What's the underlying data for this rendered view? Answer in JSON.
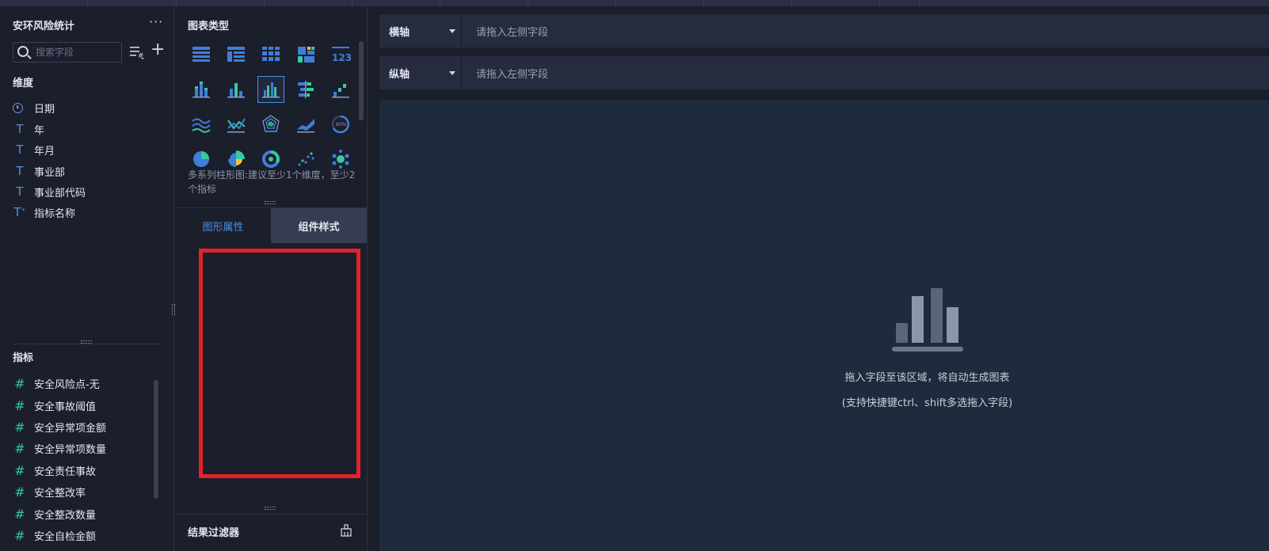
{
  "dataset": {
    "title": "安环风险统计",
    "more": "···",
    "search_placeholder": "搜索字段"
  },
  "dimensions": {
    "label": "维度",
    "items": [
      {
        "icon": "clock-icon",
        "label": "日期"
      },
      {
        "icon": "text-type-icon",
        "label": "年"
      },
      {
        "icon": "text-type-icon",
        "label": "年月"
      },
      {
        "icon": "text-type-icon",
        "label": "事业部"
      },
      {
        "icon": "text-type-icon",
        "label": "事业部代码"
      },
      {
        "icon": "text-type-calc-icon",
        "label": "指标名称"
      }
    ]
  },
  "metrics": {
    "label": "指标",
    "items": [
      {
        "icon": "hash-icon",
        "label": "安全风险点-无"
      },
      {
        "icon": "hash-icon",
        "label": "安全事故阈值"
      },
      {
        "icon": "hash-icon",
        "label": "安全异常项金额"
      },
      {
        "icon": "hash-icon",
        "label": "安全异常项数量"
      },
      {
        "icon": "hash-icon",
        "label": "安全责任事故"
      },
      {
        "icon": "hash-icon",
        "label": "安全整改率"
      },
      {
        "icon": "hash-icon",
        "label": "安全整改数量"
      },
      {
        "icon": "hash-icon",
        "label": "安全自检金额"
      }
    ]
  },
  "chart_types": {
    "title": "图表类型",
    "hint": "多系列柱形图:建议至少1个维度，至少2个指标",
    "selected_index": 7
  },
  "tabs": {
    "graph_props": "图形属性",
    "component_style": "组件样式"
  },
  "filter": {
    "title": "结果过滤器"
  },
  "axes": {
    "x_label": "横轴",
    "y_label": "纵轴",
    "placeholder": "请拖入左侧字段"
  },
  "canvas": {
    "empty_line1": "拖入字段至该区域，将自动生成图表",
    "empty_line2": "(支持快捷键ctrl、shift多选拖入字段)"
  },
  "colors": {
    "accent": "#4a90f0",
    "highlight_box": "#e3222a",
    "metric_icon": "#34c3a3"
  }
}
